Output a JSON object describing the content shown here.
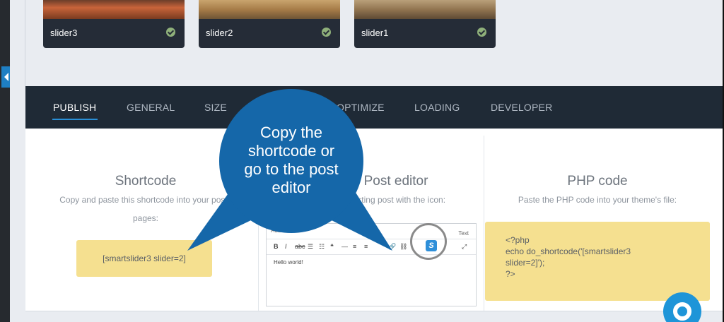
{
  "sliders": [
    {
      "name": "slider3"
    },
    {
      "name": "slider2"
    },
    {
      "name": "slider1"
    }
  ],
  "tabs": [
    {
      "label": "PUBLISH",
      "active": true
    },
    {
      "label": "GENERAL"
    },
    {
      "label": "SIZE"
    },
    {
      "label": "OPTIMIZE"
    },
    {
      "label": "LOADING"
    },
    {
      "label": "DEVELOPER"
    }
  ],
  "shortcode": {
    "title": "Shortcode",
    "desc_line1": "Copy and paste this shortcode into your posts",
    "desc_line2": "pages:",
    "code": "[smartslider3 slider=2]"
  },
  "post_editor": {
    "title": "Post editor",
    "desc": "existing post with the icon:",
    "add_media": "Add Media",
    "text_tab": "Text",
    "body_text": "Hello world!",
    "slider_icon_letter": "S"
  },
  "php": {
    "title": "PHP code",
    "desc": "Paste the PHP code into your theme's file:",
    "line1": "<?php",
    "line2": "echo do_shortcode('[smartslider3",
    "line3": "slider=2]');",
    "line4": "?>"
  },
  "callout": {
    "line1": "Copy the",
    "line2": "shortcode or",
    "line3": "go to the post",
    "line4": "editor"
  },
  "colors": {
    "tabbar_bg": "#1f2a36",
    "accent": "#2a8fd6",
    "callout": "#1567a9",
    "code_bg": "#f5e090"
  }
}
